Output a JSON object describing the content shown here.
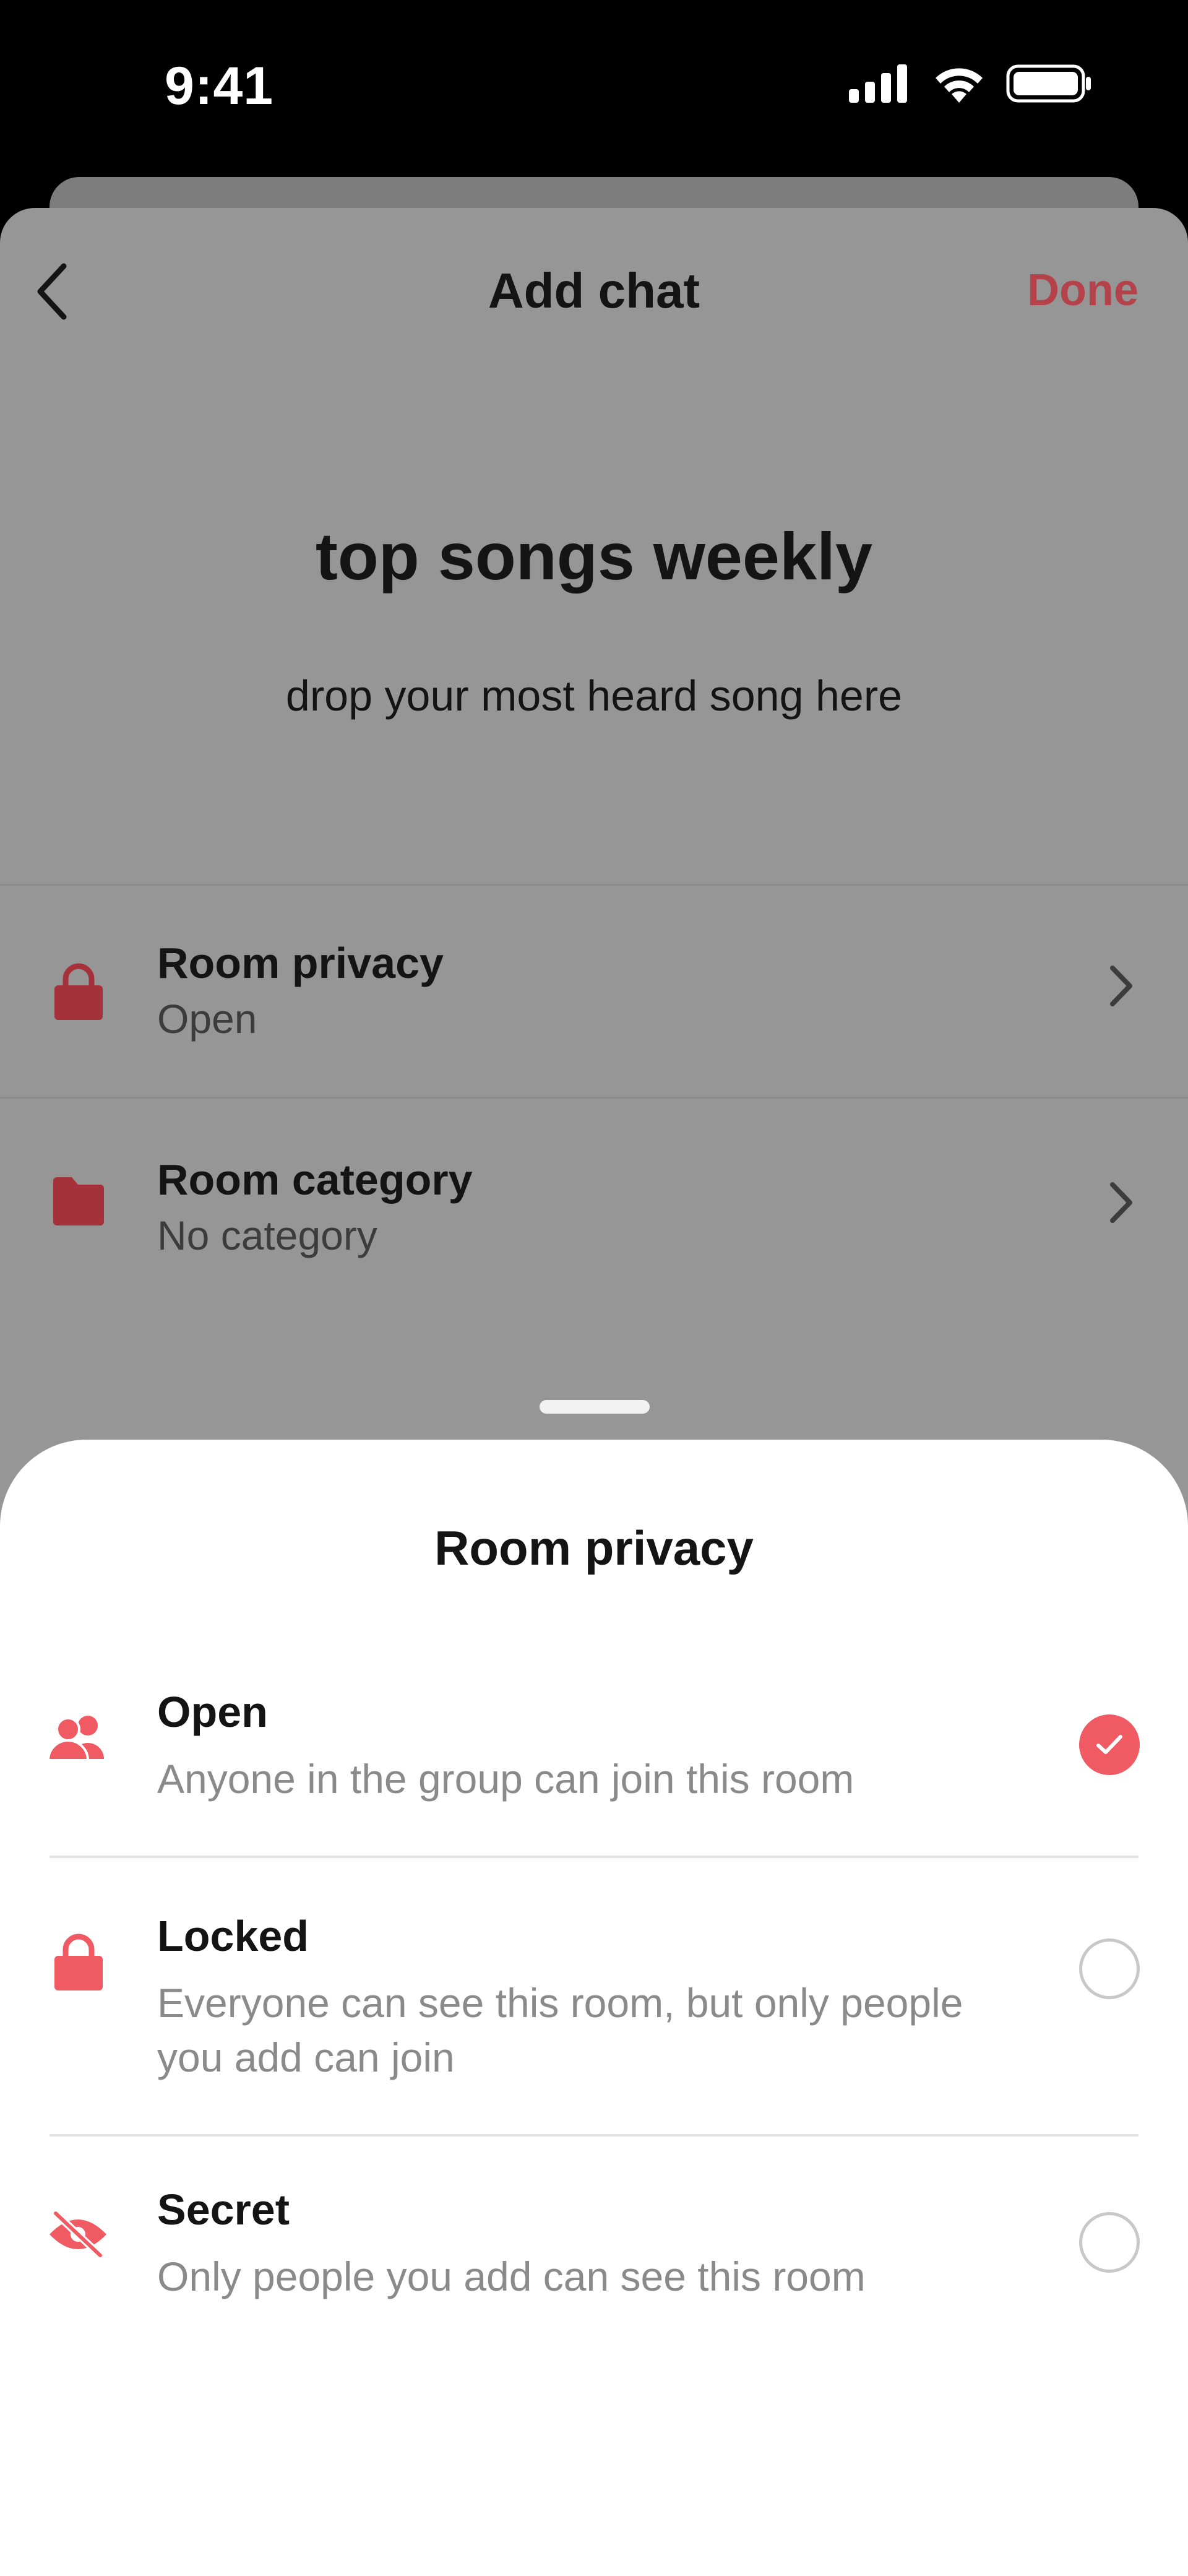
{
  "status_bar": {
    "time": "9:41",
    "icons": [
      "cellular-signal-icon",
      "wifi-icon",
      "battery-icon"
    ]
  },
  "nav": {
    "back_icon": "chevron-left-icon",
    "title": "Add chat",
    "done_label": "Done"
  },
  "room": {
    "name": "top songs weekly",
    "description": "drop your most heard song here"
  },
  "settings": [
    {
      "icon": "lock-icon",
      "title": "Room privacy",
      "value": "Open"
    },
    {
      "icon": "folder-icon",
      "title": "Room category",
      "value": "No category"
    }
  ],
  "sheet": {
    "title": "Room privacy",
    "options": [
      {
        "icon": "people-icon",
        "title": "Open",
        "description": "Anyone in the group can join this room",
        "selected": true
      },
      {
        "icon": "lock-icon",
        "title": "Locked",
        "description": "Everyone can see this room, but only people you add can join",
        "selected": false
      },
      {
        "icon": "eye-slash-icon",
        "title": "Secret",
        "description": "Only people you add can see this room",
        "selected": false
      }
    ]
  },
  "colors": {
    "accent": "#ef5a63",
    "accent_dim": "#b4424a",
    "overlay_gray": "#969696",
    "sheet_background": "#ffffff"
  }
}
